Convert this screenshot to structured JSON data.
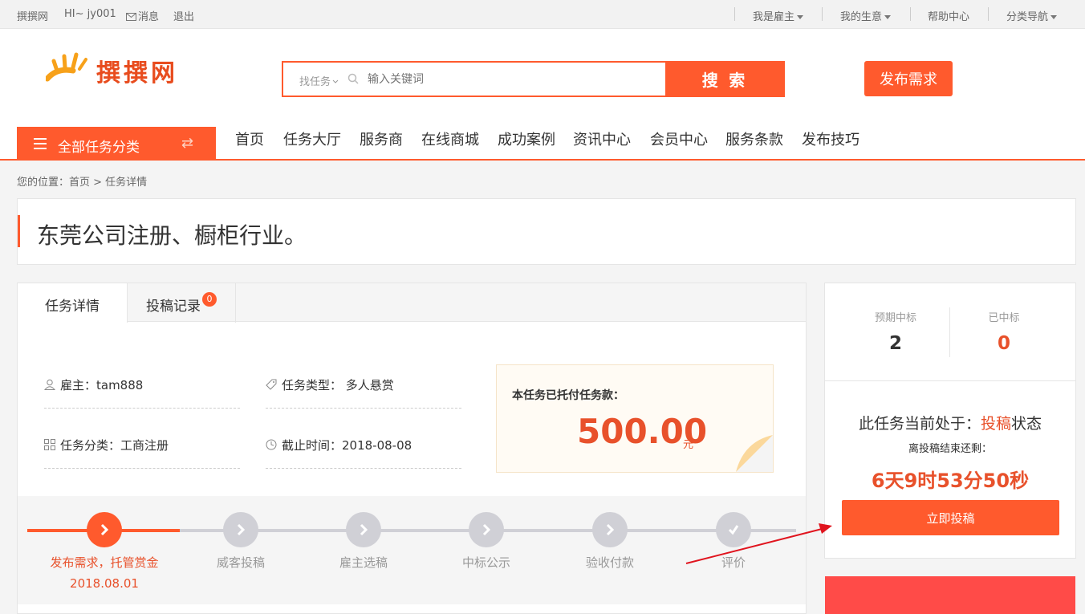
{
  "topbar": {
    "site": "撰撰网",
    "greeting": "HI~ jy001",
    "messages": "消息",
    "logout": "退出",
    "employer": "我是雇主",
    "my_business": "我的生意",
    "help": "帮助中心",
    "category_nav": "分类导航"
  },
  "header": {
    "logo_text": "撰撰网",
    "search_type": "找任务",
    "search_placeholder": "输入关键词",
    "search_button": "搜 索",
    "publish_button": "发布需求"
  },
  "nav": {
    "all_categories": "全部任务分类",
    "items": [
      "首页",
      "任务大厅",
      "服务商",
      "在线商城",
      "成功案例",
      "资讯中心",
      "会员中心",
      "服务条款",
      "发布技巧"
    ]
  },
  "breadcrumb": "您的位置：首页 > 任务详情",
  "task": {
    "title": "东莞公司注册、橱柜行业。",
    "tabs": {
      "detail": "任务详情",
      "records": "投稿记录",
      "records_count": "0"
    },
    "employer": "雇主：tam888",
    "type": "任务类型： 多人悬赏",
    "category": "任务分类：工商注册",
    "deadline": "截止时间：2018-08-08",
    "payment_label": "本任务已托付任务款：",
    "payment_amount": "500.00",
    "payment_unit": "元"
  },
  "progress": {
    "current_step": 1,
    "steps": [
      {
        "label": "发布需求，托管赏金",
        "date": "2018.08.01"
      },
      {
        "label": "威客投稿"
      },
      {
        "label": "雇主选稿"
      },
      {
        "label": "中标公示"
      },
      {
        "label": "验收付款"
      },
      {
        "label": "评价"
      }
    ]
  },
  "side": {
    "expected_label": "预期中标",
    "expected_value": "2",
    "won_label": "已中标",
    "won_value": "0",
    "state_prefix": "此任务当前处于：",
    "state_value": "投稿",
    "state_suffix": "状态",
    "remaining_label": "离投稿结束还剩：",
    "countdown": "6天9时53分50秒",
    "submit_button": "立即投稿"
  },
  "colors": {
    "accent": "#ff5a2d",
    "accent_text": "#e8512b",
    "step_inactive": "#d0d0d6"
  }
}
